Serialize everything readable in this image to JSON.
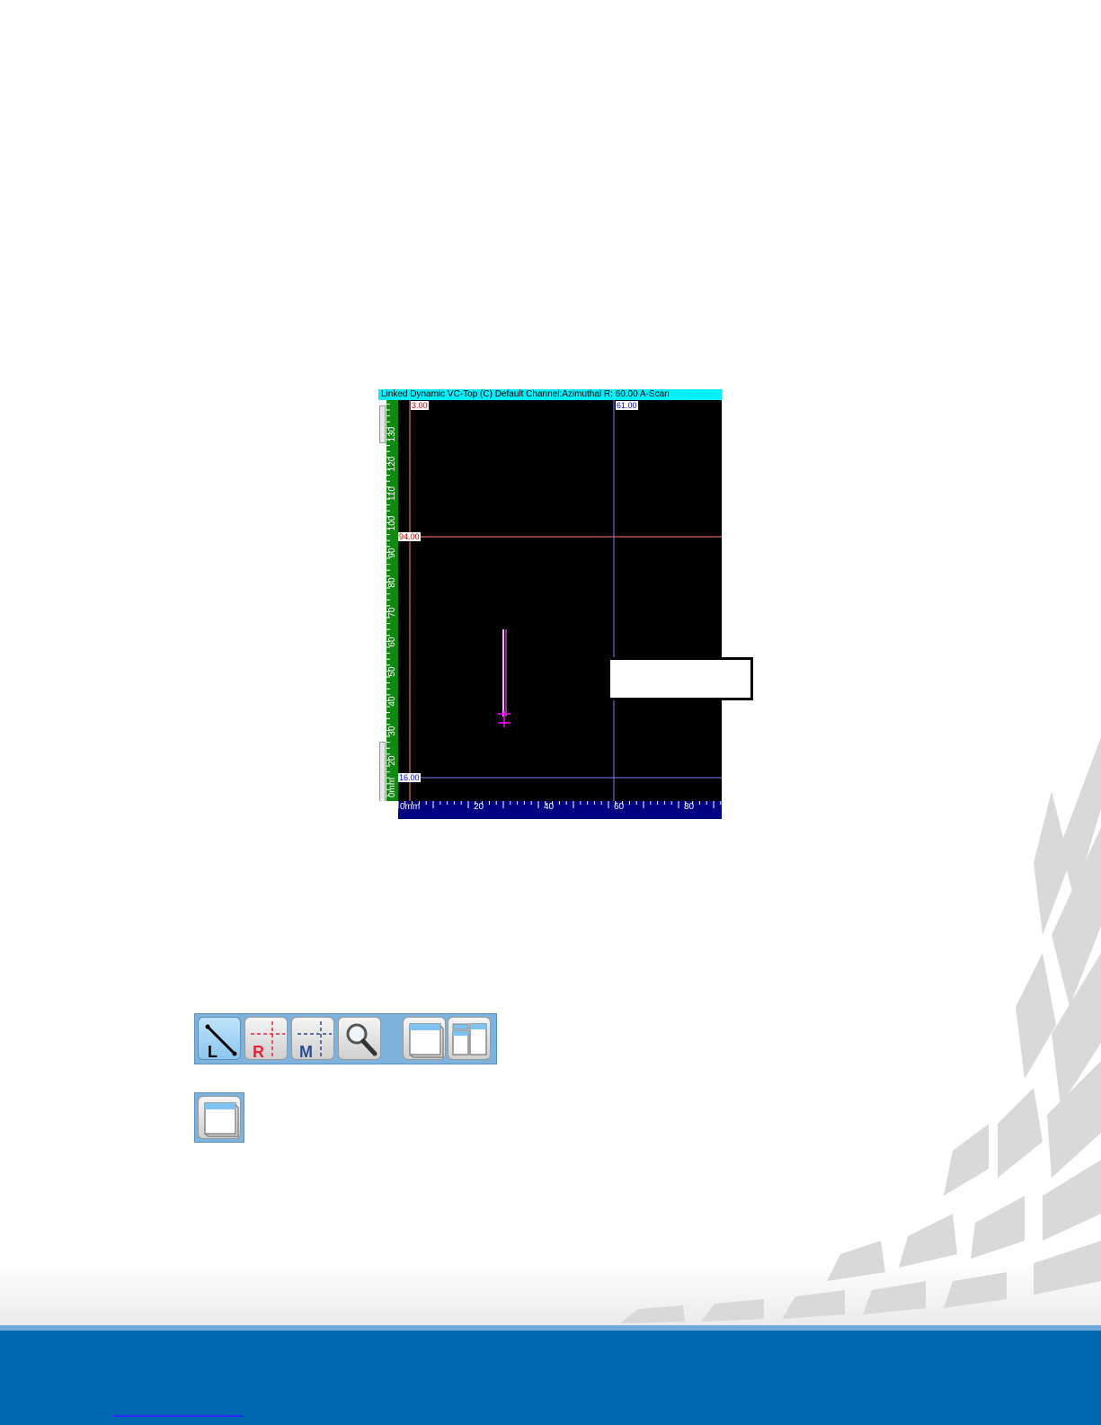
{
  "scan_view": {
    "title": "Linked Dynamic VC-Top (C) Default Channel:Azimuthal   R: 60.00 A-Scan",
    "cursors": {
      "reference_x_label": "3.00",
      "measure_x_label": "61.00",
      "reference_y_label": "94.00",
      "measure_y_label": "16.00"
    },
    "vertical_axis": {
      "unit_label": "0mm",
      "tick_labels": [
        "20",
        "30",
        "40",
        "50",
        "60",
        "70",
        "80",
        "90",
        "100",
        "110",
        "120",
        "130"
      ]
    },
    "horizontal_axis": {
      "unit_label": "0mm",
      "tick_labels": [
        "20",
        "40",
        "60",
        "80"
      ]
    },
    "colors": {
      "title_bar": "#00f0ff",
      "background": "#000000",
      "vertical_ruler": "#0f8a0f",
      "horizontal_ruler": "#000080",
      "reference_cursor": "#ff8080",
      "measure_cursor": "#8080ff",
      "indication": "#ff00ff"
    }
  },
  "callout": {
    "text": ""
  },
  "toolbar": {
    "buttons": [
      {
        "name": "L",
        "icon": "line-measure-icon",
        "active": true
      },
      {
        "name": "R",
        "icon": "reference-cursor-icon",
        "active": false
      },
      {
        "name": "M",
        "icon": "measure-cursor-icon",
        "active": false
      },
      {
        "name": "",
        "icon": "zoom-magnifier-icon",
        "active": false
      },
      {
        "name": "",
        "icon": "single-layout-icon",
        "active": false
      },
      {
        "name": "",
        "icon": "split-layout-icon",
        "active": false
      }
    ]
  },
  "single_layout_button": {
    "icon": "single-layout-icon"
  },
  "footer": {
    "color": "#0068b3"
  }
}
